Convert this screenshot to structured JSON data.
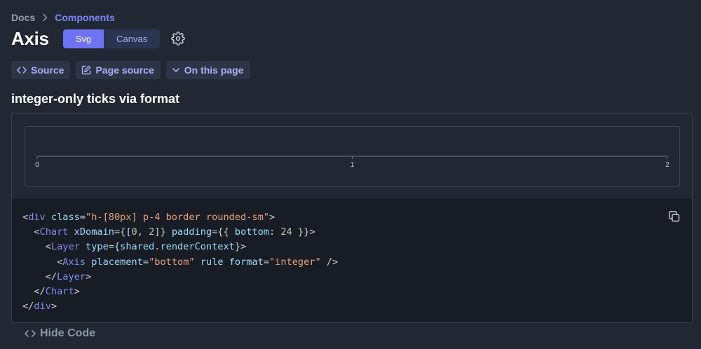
{
  "breadcrumb": {
    "root": "Docs",
    "current": "Components"
  },
  "page": {
    "title": "Axis"
  },
  "render_toggle": {
    "options": [
      "Svg",
      "Canvas"
    ],
    "selected": "Svg"
  },
  "actions": {
    "source": "Source",
    "page_source": "Page source",
    "on_this_page": "On this page"
  },
  "section": {
    "title": "integer-only ticks via format"
  },
  "preview": {
    "axis_ticks": [
      "0",
      "1",
      "2"
    ],
    "domain": [
      0,
      2
    ]
  },
  "code": {
    "lines": [
      "<div class=\"h-[80px] p-4 border rounded-sm\">",
      "  <Chart xDomain={[0, 2]} padding={{ bottom: 24 }}>",
      "    <Layer type={shared.renderContext}>",
      "      <Axis placement=\"bottom\" rule format=\"integer\" />",
      "    </Layer>",
      "  </Chart>",
      "</div>"
    ]
  },
  "footer": {
    "hide_code": "Hide Code"
  },
  "colors": {
    "accent": "#6d73f3",
    "background": "#212733",
    "code_bg": "#181c24"
  }
}
